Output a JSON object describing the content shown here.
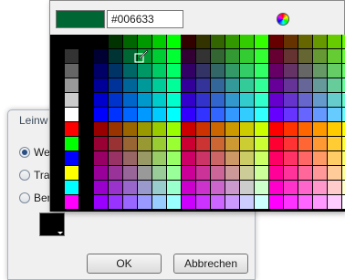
{
  "picker": {
    "current_color": "#006633",
    "hex_value": "#006633"
  },
  "dialog": {
    "title": "Leinw",
    "radios": [
      {
        "label": "We",
        "checked": true
      },
      {
        "label": "Tra",
        "checked": false
      },
      {
        "label": "Ber",
        "checked": false
      }
    ],
    "swatch_color": "#000000",
    "ok_label": "OK",
    "cancel_label": "Abbrechen"
  },
  "icons": {
    "color_wheel": "color-wheel-icon",
    "eyedropper": "eyedropper-icon"
  }
}
